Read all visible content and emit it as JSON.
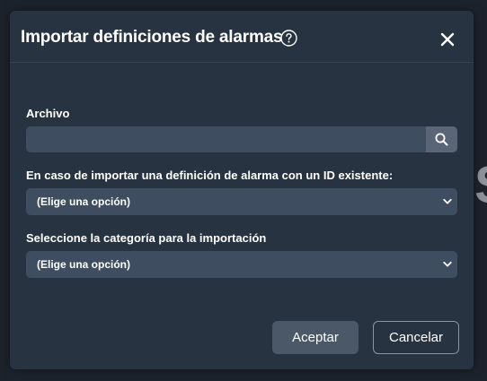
{
  "dialog": {
    "title": "Importar definiciones de alarmas",
    "help_icon": "question-circle-icon",
    "close_icon": "close-x-icon"
  },
  "file_field": {
    "label": "Archivo",
    "value": "",
    "placeholder": "",
    "search_icon": "search-icon"
  },
  "existing_id_field": {
    "label": "En caso de importar una definición de alarma con un ID existente:",
    "selected": "(Elige una opción)"
  },
  "category_field": {
    "label": "Seleccione la categoría para la importación",
    "selected": "(Elige una opción)"
  },
  "footer": {
    "accept_label": "Aceptar",
    "cancel_label": "Cancelar"
  },
  "colors": {
    "modal_background": "#283341",
    "input_background": "#3f4d61",
    "page_background": "#1d232d",
    "primary_button": "#4b5868"
  }
}
